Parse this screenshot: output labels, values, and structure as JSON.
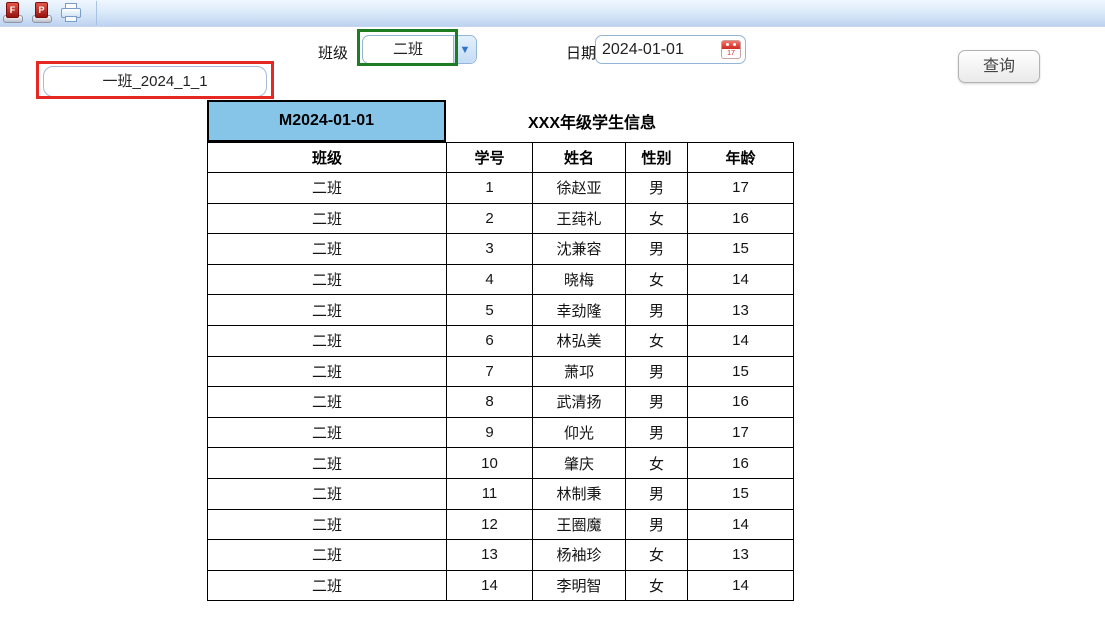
{
  "toolbar": {
    "icons": [
      {
        "name": "export-pdf-f-icon",
        "letter": "F"
      },
      {
        "name": "export-pdf-p-icon",
        "letter": "P"
      },
      {
        "name": "print-icon"
      }
    ]
  },
  "tab": {
    "label": "一班_2024_1_1"
  },
  "filters": {
    "class_label": "班级",
    "class_selected": "二班",
    "date_label": "日期",
    "date_value": "2024-01-01",
    "query_button_label": "查询"
  },
  "icons": {
    "chevron_down": "▼",
    "calendar_day": "17"
  },
  "report": {
    "code": "M2024-01-01",
    "title": "XXX年级学生信息",
    "columns": [
      "班级",
      "学号",
      "姓名",
      "性别",
      "年龄"
    ],
    "rows": [
      [
        "二班",
        "1",
        "徐赵亚",
        "男",
        "17"
      ],
      [
        "二班",
        "2",
        "王莼礼",
        "女",
        "16"
      ],
      [
        "二班",
        "3",
        "沈兼容",
        "男",
        "15"
      ],
      [
        "二班",
        "4",
        "晓梅",
        "女",
        "14"
      ],
      [
        "二班",
        "5",
        "幸劲隆",
        "男",
        "13"
      ],
      [
        "二班",
        "6",
        "林弘美",
        "女",
        "14"
      ],
      [
        "二班",
        "7",
        "萧邛",
        "男",
        "15"
      ],
      [
        "二班",
        "8",
        "武清扬",
        "男",
        "16"
      ],
      [
        "二班",
        "9",
        "仰光",
        "男",
        "17"
      ],
      [
        "二班",
        "10",
        "肇庆",
        "女",
        "16"
      ],
      [
        "二班",
        "11",
        "林制秉",
        "男",
        "15"
      ],
      [
        "二班",
        "12",
        "王圈魔",
        "男",
        "14"
      ],
      [
        "二班",
        "13",
        "杨袖珍",
        "女",
        "13"
      ],
      [
        "二班",
        "14",
        "李明智",
        "女",
        "14"
      ]
    ]
  },
  "colors": {
    "header_blue": "#87c5e8",
    "annotation_red": "#e62823",
    "annotation_green": "#1e7d23"
  }
}
